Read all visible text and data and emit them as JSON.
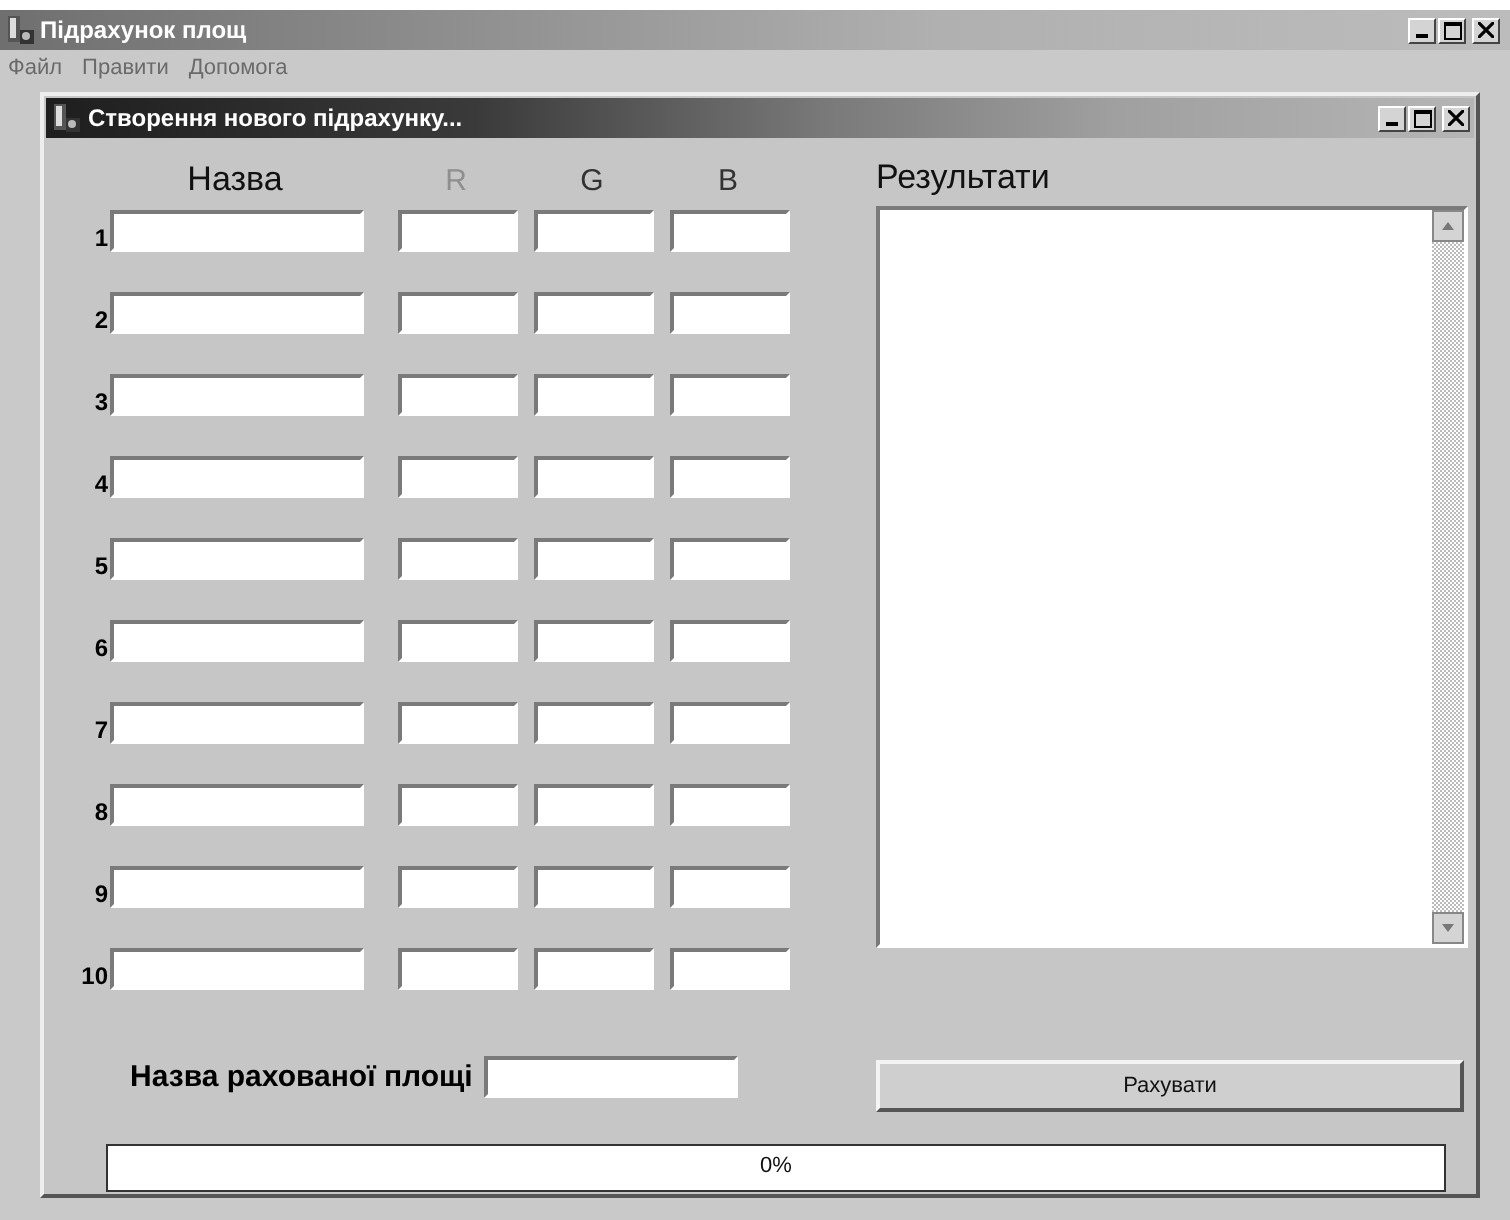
{
  "window": {
    "title": "Підрахунок площ"
  },
  "menu": [
    "Файл",
    "Правити",
    "Допомога"
  ],
  "dialog": {
    "title": "Створення нового підрахунку...",
    "columns": [
      {
        "label": "Назва",
        "disabled": false
      },
      {
        "label": "R",
        "disabled": true
      },
      {
        "label": "G",
        "disabled": false
      },
      {
        "label": "B",
        "disabled": false
      }
    ],
    "rows": [
      {
        "number": "1"
      },
      {
        "number": "2"
      },
      {
        "number": "3"
      },
      {
        "number": "4"
      },
      {
        "number": "5"
      },
      {
        "number": "6"
      },
      {
        "number": "7"
      },
      {
        "number": "8"
      },
      {
        "number": "9"
      },
      {
        "number": "10"
      }
    ],
    "area_name": {
      "label": "Назва рахованої площі"
    },
    "results": {
      "label": "Результати"
    },
    "button": "Рахувати",
    "progress": {
      "level": 0,
      "reading": "0%"
    }
  }
}
